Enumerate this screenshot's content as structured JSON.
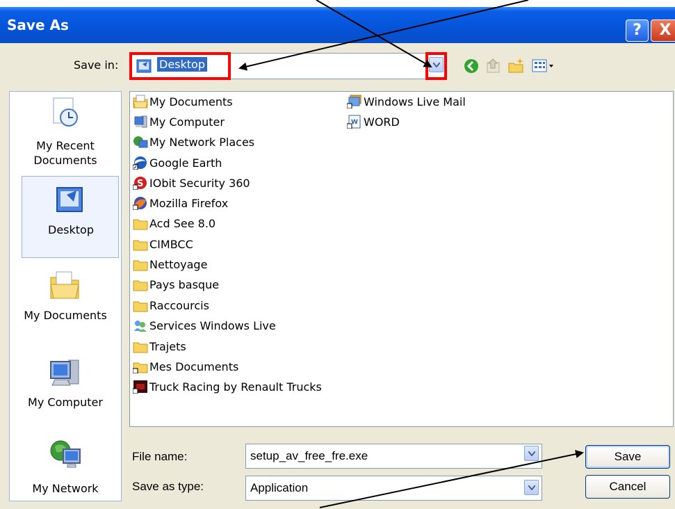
{
  "dialog": {
    "title": "Save As",
    "help_label": "?",
    "close_label": "X"
  },
  "toolbar": {
    "save_in_label": "Save in:",
    "location_value": "Desktop"
  },
  "places": [
    {
      "label_line1": "My Recent",
      "label_line2": "Documents",
      "icon": "recent-documents-icon"
    },
    {
      "label_line1": "Desktop",
      "label_line2": "",
      "icon": "desktop-icon"
    },
    {
      "label_line1": "My Documents",
      "label_line2": "",
      "icon": "my-documents-icon"
    },
    {
      "label_line1": "My Computer",
      "label_line2": "",
      "icon": "my-computer-icon"
    },
    {
      "label_line1": "My Network",
      "label_line2": "",
      "icon": "my-network-icon"
    }
  ],
  "files_col1": [
    {
      "name": "My Documents",
      "icon": "my-documents-icon"
    },
    {
      "name": "My Computer",
      "icon": "my-computer-icon"
    },
    {
      "name": "My Network Places",
      "icon": "network-places-icon"
    },
    {
      "name": "Google Earth",
      "icon": "google-earth-icon"
    },
    {
      "name": "IObit Security 360",
      "icon": "iobit-icon"
    },
    {
      "name": "Mozilla Firefox",
      "icon": "firefox-icon"
    },
    {
      "name": "Acd See 8.0",
      "icon": "folder-icon"
    },
    {
      "name": "CIMBCC",
      "icon": "folder-icon"
    },
    {
      "name": "Nettoyage",
      "icon": "folder-icon"
    },
    {
      "name": "Pays basque",
      "icon": "folder-icon"
    },
    {
      "name": "Raccourcis",
      "icon": "folder-icon"
    },
    {
      "name": "Services Windows Live",
      "icon": "windows-live-icon"
    },
    {
      "name": "Trajets",
      "icon": "folder-icon"
    },
    {
      "name": "Mes Documents",
      "icon": "folder-shortcut-icon"
    },
    {
      "name": "Truck Racing by Renault Trucks",
      "icon": "truck-racing-icon"
    }
  ],
  "files_col2": [
    {
      "name": "Windows Live Mail",
      "icon": "windows-live-mail-icon"
    },
    {
      "name": "WORD",
      "icon": "word-icon"
    }
  ],
  "form": {
    "file_name_label": "File name:",
    "file_name_value": "setup_av_free_fre.exe",
    "save_type_label": "Save as type:",
    "save_type_value": "Application",
    "save_button": "Save",
    "cancel_button": "Cancel"
  },
  "colors": {
    "title_bar": "#0553d9",
    "annotation_red": "#ff0000",
    "dialog_bg": "#ece9d8"
  }
}
